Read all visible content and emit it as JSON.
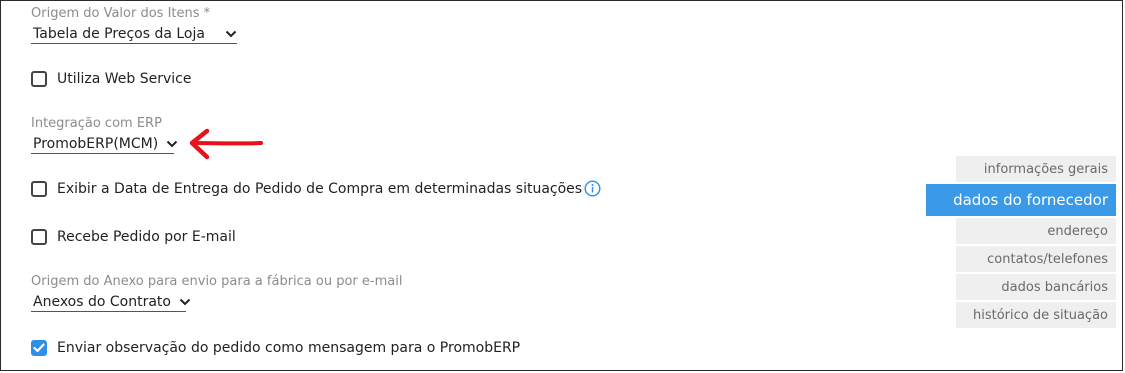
{
  "form": {
    "origem_valor": {
      "label": "Origem do Valor dos Itens *",
      "value": "Tabela de Preços da Loja"
    },
    "web_service": {
      "label": "Utiliza Web Service",
      "checked": false
    },
    "integracao_erp": {
      "label": "Integração com ERP",
      "value": "PromobERP(MCM)"
    },
    "data_entrega": {
      "label": "Exibir a Data de Entrega do Pedido de Compra em determinadas situações",
      "checked": false
    },
    "recebe_email": {
      "label": "Recebe Pedido por E-mail",
      "checked": false
    },
    "origem_anexo": {
      "label": "Origem do Anexo para envio para a fábrica ou por e-mail",
      "value": "Anexos do Contrato"
    },
    "enviar_obs": {
      "label": "Enviar observação do pedido como mensagem para o PromobERP",
      "checked": true
    }
  },
  "side_tabs": [
    {
      "label": "informações gerais",
      "active": false
    },
    {
      "label": "dados do fornecedor",
      "active": true
    },
    {
      "label": "endereço",
      "active": false
    },
    {
      "label": "contatos/telefones",
      "active": false
    },
    {
      "label": "dados bancários",
      "active": false
    },
    {
      "label": "histórico de situação",
      "active": false
    }
  ],
  "colors": {
    "accent": "#3a9ae8",
    "annotation_arrow": "#e8101a"
  },
  "icons": {
    "info": "info-circle-icon",
    "chevron": "chevron-down-icon",
    "annotation": "red-arrow-annotation"
  }
}
